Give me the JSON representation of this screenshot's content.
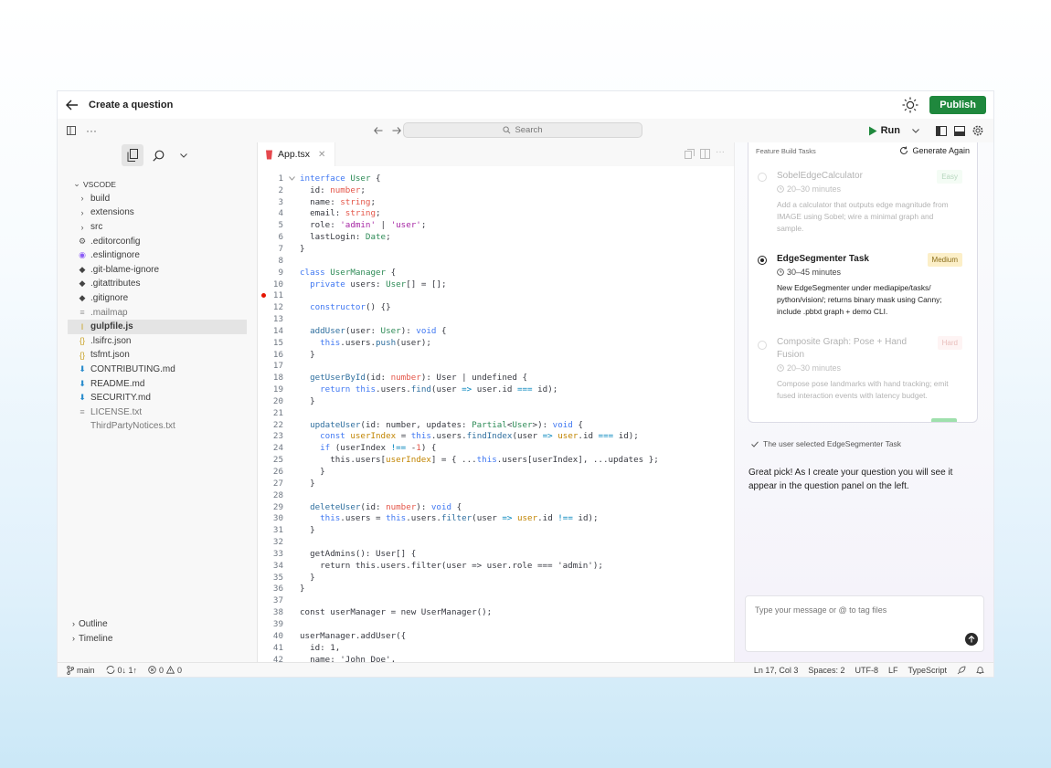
{
  "header": {
    "title": "Create a question",
    "publish_label": "Publish"
  },
  "toolbar": {
    "search_placeholder": "Search",
    "run_label": "Run",
    "more": "···"
  },
  "explorer": {
    "root": "VSCODE",
    "items": [
      {
        "label": "build",
        "type": "folder"
      },
      {
        "label": "extensions",
        "type": "folder"
      },
      {
        "label": "src",
        "type": "folder"
      },
      {
        "label": ".editorconfig",
        "type": "gear"
      },
      {
        "label": ".eslintignore",
        "type": "eslint"
      },
      {
        "label": ".git-blame-ignore",
        "type": "git"
      },
      {
        "label": ".gitattributes",
        "type": "git"
      },
      {
        "label": ".gitignore",
        "type": "git"
      },
      {
        "label": ".mailmap",
        "type": "text"
      },
      {
        "label": "gulpfile.js",
        "type": "js"
      },
      {
        "label": ".lsifrc.json",
        "type": "json"
      },
      {
        "label": "tsfmt.json",
        "type": "json"
      },
      {
        "label": "CONTRIBUTING.md",
        "type": "md"
      },
      {
        "label": "README.md",
        "type": "md"
      },
      {
        "label": "SECURITY.md",
        "type": "md"
      },
      {
        "label": "LICENSE.txt",
        "type": "text"
      },
      {
        "label": "ThirdPartyNotices.txt",
        "type": "plain"
      }
    ],
    "outline": "Outline",
    "timeline": "Timeline"
  },
  "editor": {
    "tab_label": "App.tsx"
  },
  "code_lines": [
    "<span class=\"k\">interface</span> <span class=\"t\">User</span> {",
    "  id: <span class=\"n\">number</span>;",
    "  name: <span class=\"n\">string</span>;",
    "  email: <span class=\"n\">string</span>;",
    "  role: <span class=\"s\">'admin'</span> | <span class=\"s\">'user'</span>;",
    "  lastLogin: <span class=\"t\">Date</span>;",
    "}",
    "",
    "<span class=\"k\">class</span> <span class=\"t\">UserManager</span> {",
    "  <span class=\"k\">private</span> users: <span class=\"t\">User</span>[] = [];",
    "",
    "  <span class=\"k\">constructor</span>() {}",
    "",
    "  <span class=\"p\">addUser</span>(user: <span class=\"t\">User</span>): <span class=\"k\">void</span> {",
    "    <span class=\"k\">this</span>.users.<span class=\"p\">push</span>(user);",
    "  }",
    "",
    "  <span class=\"p\">getUserById</span>(id: <span class=\"n\">number</span>): User | undefined {",
    "    <span class=\"k\">return</span> <span class=\"k\">this</span>.users.<span class=\"p\">find</span>(user <span class=\"o\">=&gt;</span> user.id <span class=\"o\">===</span> id);",
    "  }",
    "",
    "  <span class=\"p\">updateUser</span>(id: number, updates: <span class=\"t\">Partial</span>&lt;<span class=\"t\">User</span>&gt;): <span class=\"k\">void</span> {",
    "    <span class=\"k\">const</span> <span class=\"f\">userIndex</span> = <span class=\"k\">this</span>.users.<span class=\"p\">findIndex</span>(user <span class=\"o\">=&gt;</span> <span class=\"f\">user</span>.id <span class=\"o\">===</span> id);",
    "    <span class=\"k\">if</span> (userIndex <span class=\"o\">!==</span> -<span class=\"n\">1</span>) {",
    "      this.users[<span class=\"f\">userIndex</span>] = { ...<span class=\"k\">this</span>.users[userIndex], ...updates };",
    "    }",
    "  }",
    "",
    "  <span class=\"p\">deleteUser</span>(id: <span class=\"n\">number</span>): <span class=\"k\">void</span> {",
    "    <span class=\"k\">this</span>.users = <span class=\"k\">this</span>.users.<span class=\"p\">filter</span>(user <span class=\"o\">=&gt;</span> <span class=\"f\">user</span>.id <span class=\"o\">!==</span> id);",
    "  }",
    "",
    "  getAdmins(): User[] {",
    "    return this.users.filter(user =&gt; user.role === 'admin');",
    "  }",
    "}",
    "",
    "const userManager = new UserManager();",
    "",
    "userManager.addUser({",
    "  id: 1,",
    "  name: 'John Doe',"
  ],
  "tasks": {
    "header": "Feature Build Tasks",
    "regenerate_label": "Generate Again",
    "items": [
      {
        "title": "SobelEdgeCalculator",
        "difficulty": "Easy",
        "time": "20–30 minutes",
        "desc": "Add a calculator that outputs edge magnitude from IMAGE using Sobel; wire a minimal graph and sample."
      },
      {
        "title": "EdgeSegmenter Task",
        "difficulty": "Medium",
        "time": "30–45 minutes",
        "desc": "New EdgeSegmenter under mediapipe/tasks/ python/vision/; returns binary mask using Canny; include .pbtxt graph + demo CLI."
      },
      {
        "title": "Composite Graph: Pose + Hand Fusion",
        "difficulty": "Hard",
        "time": "20–30 minutes",
        "desc": "Compose pose landmarks with hand tracking; emit fused interaction events with latency budget."
      }
    ]
  },
  "chat": {
    "selection_note": "The user selected EdgeSegmenter Task",
    "reply": "Great pick! As I create your question you will see it appear in the question panel on the left.",
    "input_placeholder": "Type your message or @ to tag files"
  },
  "status": {
    "branch": "main",
    "sync": "0↓ 1↑",
    "errors": "0",
    "warnings": "0",
    "position": "Ln 17, Col 3",
    "spaces": "Spaces: 2",
    "encoding": "UTF-8",
    "eol": "LF",
    "language": "TypeScript"
  },
  "colors": {
    "publish": "#1f883d",
    "run_icon": "#1f883d",
    "breakpoint": "#e51400"
  }
}
